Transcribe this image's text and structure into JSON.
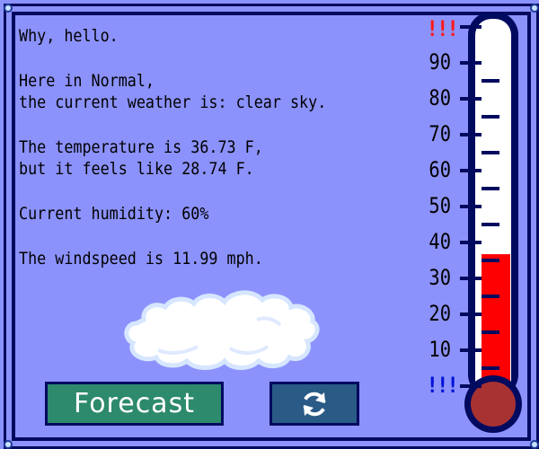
{
  "message": {
    "greeting": "Why, hello.",
    "location_line": "Here in Normal,",
    "weather_line": "the current weather is: clear sky.",
    "temperature_line": "The temperature is 36.73 F,",
    "feels_like_line": "but it feels like 28.74 F.",
    "humidity_line": "Current humidity: 60%",
    "wind_line": "The windspeed is 11.99 mph."
  },
  "buttons": {
    "forecast_label": "Forecast",
    "refresh_icon": "refresh-icon"
  },
  "thermometer": {
    "high_alarm": "!!!",
    "low_alarm": "!!!",
    "scale_labels": [
      "90",
      "80",
      "70",
      "60",
      "50",
      "40",
      "30",
      "20",
      "10"
    ],
    "current_temperature_f": 36.73,
    "fill_color": "#ff0000",
    "bulb_color": "#a83232"
  },
  "icons": {
    "weather": "cloud-icon"
  },
  "colors": {
    "background": "#8c92fb",
    "frame": "#000a5e",
    "forecast_button": "#2e8a6c",
    "refresh_button": "#2a5a86"
  }
}
